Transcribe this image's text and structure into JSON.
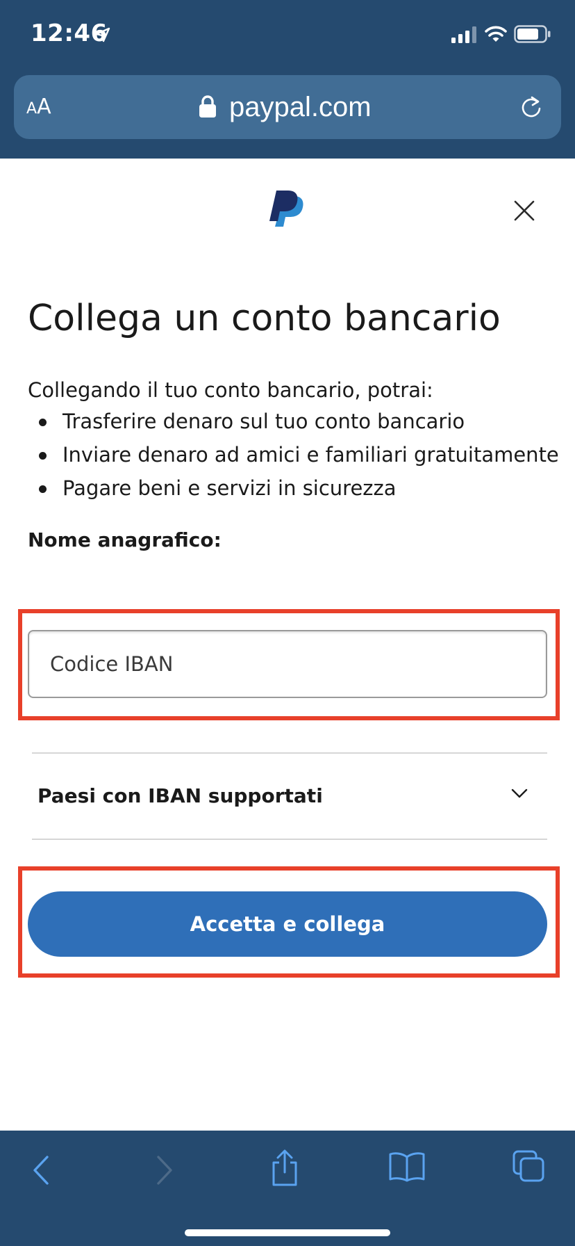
{
  "status_bar": {
    "time": "12:46",
    "icons": [
      "location-arrow-icon",
      "signal-icon",
      "wifi-icon",
      "battery-icon"
    ]
  },
  "browser": {
    "text_size_label_small": "A",
    "text_size_label_large": "A",
    "url": "paypal.com",
    "toolbar_icons": [
      "back-icon",
      "forward-icon",
      "share-icon",
      "bookmarks-icon",
      "tabs-icon"
    ]
  },
  "page": {
    "title": "Collega un conto bancario",
    "intro": "Collegando il tuo conto bancario, potrai:",
    "benefits": [
      "Trasferire denaro sul tuo conto bancario",
      "Inviare denaro ad amici e familiari gratuitamente",
      "Pagare beni e servizi in sicurezza"
    ],
    "legal_name_label": "Nome anagrafico:",
    "iban_placeholder": "Codice IBAN",
    "iban_value": "",
    "supported_countries_label": "Paesi con IBAN supportati",
    "accept_button_label": "Accetta e collega"
  },
  "colors": {
    "chrome_background": "#254a6f",
    "address_bar": "#416d95",
    "primary_button": "#2f6fb8",
    "highlight_border": "#e8402a",
    "toolbar_icon_enabled": "#5aa3f0",
    "toolbar_icon_disabled": "#4d6a88"
  }
}
